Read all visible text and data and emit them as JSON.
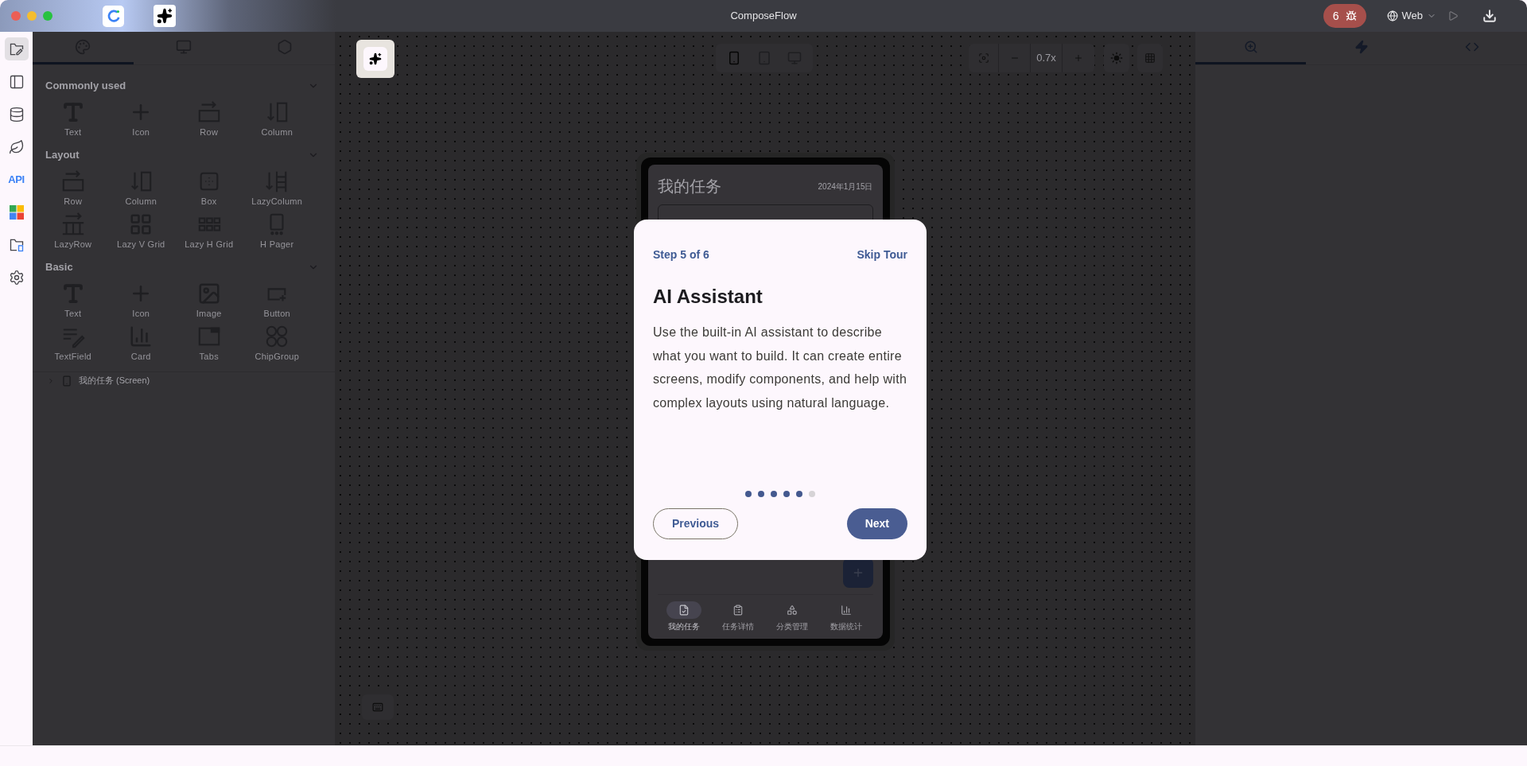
{
  "window": {
    "title": "ComposeFlow"
  },
  "title_bar": {
    "issues": "6",
    "platform": "Web"
  },
  "rail": [
    {
      "kind": "project",
      "selected": true
    },
    {
      "kind": "layout",
      "selected": false
    },
    {
      "kind": "data",
      "selected": false
    },
    {
      "kind": "theme",
      "selected": false
    },
    {
      "kind": "api",
      "label": "API",
      "selected": false
    },
    {
      "kind": "apps",
      "selected": false
    },
    {
      "kind": "files",
      "selected": false
    },
    {
      "kind": "settings",
      "selected": false
    }
  ],
  "left_tabs": [
    {
      "kind": "palette",
      "selected": true
    },
    {
      "kind": "device",
      "selected": false
    },
    {
      "kind": "modules",
      "selected": false
    }
  ],
  "sections": [
    {
      "title": "Commonly used",
      "expanded": true,
      "items": [
        {
          "label": "Text",
          "kind": "text"
        },
        {
          "label": "Icon",
          "kind": "icon"
        },
        {
          "label": "Row",
          "kind": "row"
        },
        {
          "label": "Column",
          "kind": "column"
        }
      ]
    },
    {
      "title": "Layout",
      "expanded": true,
      "items": [
        {
          "label": "Row",
          "kind": "row"
        },
        {
          "label": "Column",
          "kind": "column"
        },
        {
          "label": "Box",
          "kind": "box"
        },
        {
          "label": "LazyColumn",
          "kind": "lazycolumn"
        },
        {
          "label": "LazyRow",
          "kind": "lazyrow"
        },
        {
          "label": "Lazy V Grid",
          "kind": "vgrid"
        },
        {
          "label": "Lazy H Grid",
          "kind": "hgrid"
        },
        {
          "label": "H Pager",
          "kind": "pager"
        }
      ]
    },
    {
      "title": "Basic",
      "expanded": true,
      "items": [
        {
          "label": "Text",
          "kind": "text"
        },
        {
          "label": "Icon",
          "kind": "icon"
        },
        {
          "label": "Image",
          "kind": "image"
        },
        {
          "label": "Button",
          "kind": "button"
        },
        {
          "label": "TextField",
          "kind": "textfield"
        },
        {
          "label": "Card",
          "kind": "card"
        },
        {
          "label": "Tabs",
          "kind": "tabs"
        },
        {
          "label": "ChipGroup",
          "kind": "chips"
        }
      ]
    }
  ],
  "tree": [
    {
      "label": "我的任务 (Screen)",
      "expanded": false
    }
  ],
  "canvas": {
    "devices": [
      {
        "kind": "phone",
        "selected": true
      },
      {
        "kind": "tablet",
        "selected": false
      },
      {
        "kind": "desktop",
        "selected": false
      }
    ],
    "zoom": "0.7x",
    "phone": {
      "title": "我的任务",
      "date": "2024年1月15日",
      "nav": [
        {
          "label": "我的任务",
          "kind": "tasks",
          "selected": true
        },
        {
          "label": "任务详情",
          "kind": "details",
          "selected": false
        },
        {
          "label": "分类管理",
          "kind": "categories",
          "selected": false
        },
        {
          "label": "数据统计",
          "kind": "stats",
          "selected": false
        }
      ]
    }
  },
  "tour": {
    "step": "Step 5 of 6",
    "skip": "Skip Tour",
    "title": "AI Assistant",
    "body": "Use the built-in AI assistant to describe what you want to build. It can create entire screens, modify components, and help with complex layouts using natural language.",
    "dots": [
      {
        "done": true
      },
      {
        "done": true
      },
      {
        "done": true
      },
      {
        "done": true
      },
      {
        "done": true
      },
      {
        "done": false
      }
    ],
    "previous": "Previous",
    "next": "Next"
  },
  "right_tabs": [
    {
      "kind": "inspect",
      "selected": true
    },
    {
      "kind": "actions",
      "selected": false
    },
    {
      "kind": "code",
      "selected": false
    }
  ]
}
